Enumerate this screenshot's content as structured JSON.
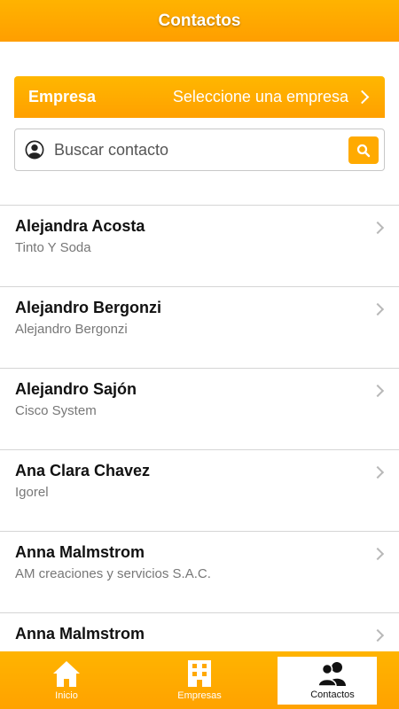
{
  "header": {
    "title": "Contactos"
  },
  "company_filter": {
    "label": "Empresa",
    "value": "Seleccione una empresa"
  },
  "search": {
    "placeholder": "Buscar contacto"
  },
  "contacts": [
    {
      "name": "Alejandra Acosta",
      "company": "Tinto Y Soda"
    },
    {
      "name": "Alejandro Bergonzi",
      "company": "Alejandro Bergonzi"
    },
    {
      "name": "Alejandro Sajón",
      "company": "Cisco System"
    },
    {
      "name": "Ana Clara Chavez",
      "company": "Igorel"
    },
    {
      "name": "Anna Malmstrom",
      "company": "AM creaciones y servicios S.A.C."
    },
    {
      "name": "Anna Malmstrom",
      "company": ""
    }
  ],
  "tabs": [
    {
      "label": "Inicio",
      "icon": "home-icon"
    },
    {
      "label": "Empresas",
      "icon": "building-icon"
    },
    {
      "label": "Contactos",
      "icon": "contacts-icon",
      "active": true
    }
  ],
  "colors": {
    "accent": "#ffa800",
    "active_tab_bg": "#ffffff"
  }
}
